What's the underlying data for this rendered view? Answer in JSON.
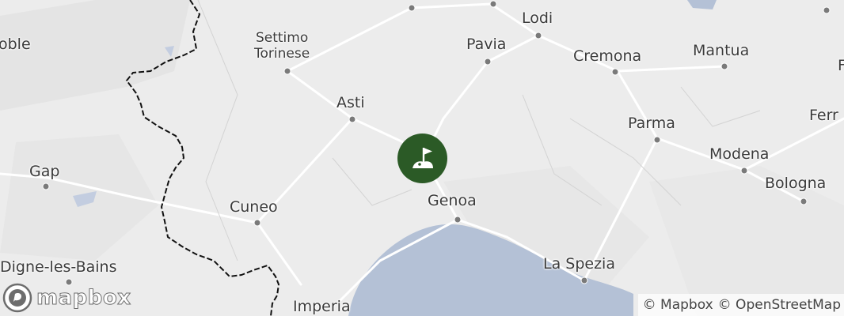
{
  "map": {
    "markers": [
      {
        "name": "golf-course-marker",
        "icon": "golf-flag-icon",
        "color": "#2b5a26"
      }
    ],
    "place_labels": [
      "oble",
      "Settimo\nTorinese",
      "Pavia",
      "Lodi",
      "Cremona",
      "Mantua",
      "Asti",
      "Parma",
      "Ferr",
      "Modena",
      "Gap",
      "Genoa",
      "Bologna",
      "Cuneo",
      "Digne-les-Bains",
      "La Spezia",
      "Imperia",
      "F"
    ],
    "colors": {
      "land": "#ececec",
      "sea": "#b4c1d6",
      "border": "#111111",
      "marker": "#2b5a26"
    }
  },
  "branding": {
    "logo_text": "mapbox"
  },
  "attribution": {
    "mapbox": "© Mapbox",
    "osm": "© OpenStreetMap"
  }
}
